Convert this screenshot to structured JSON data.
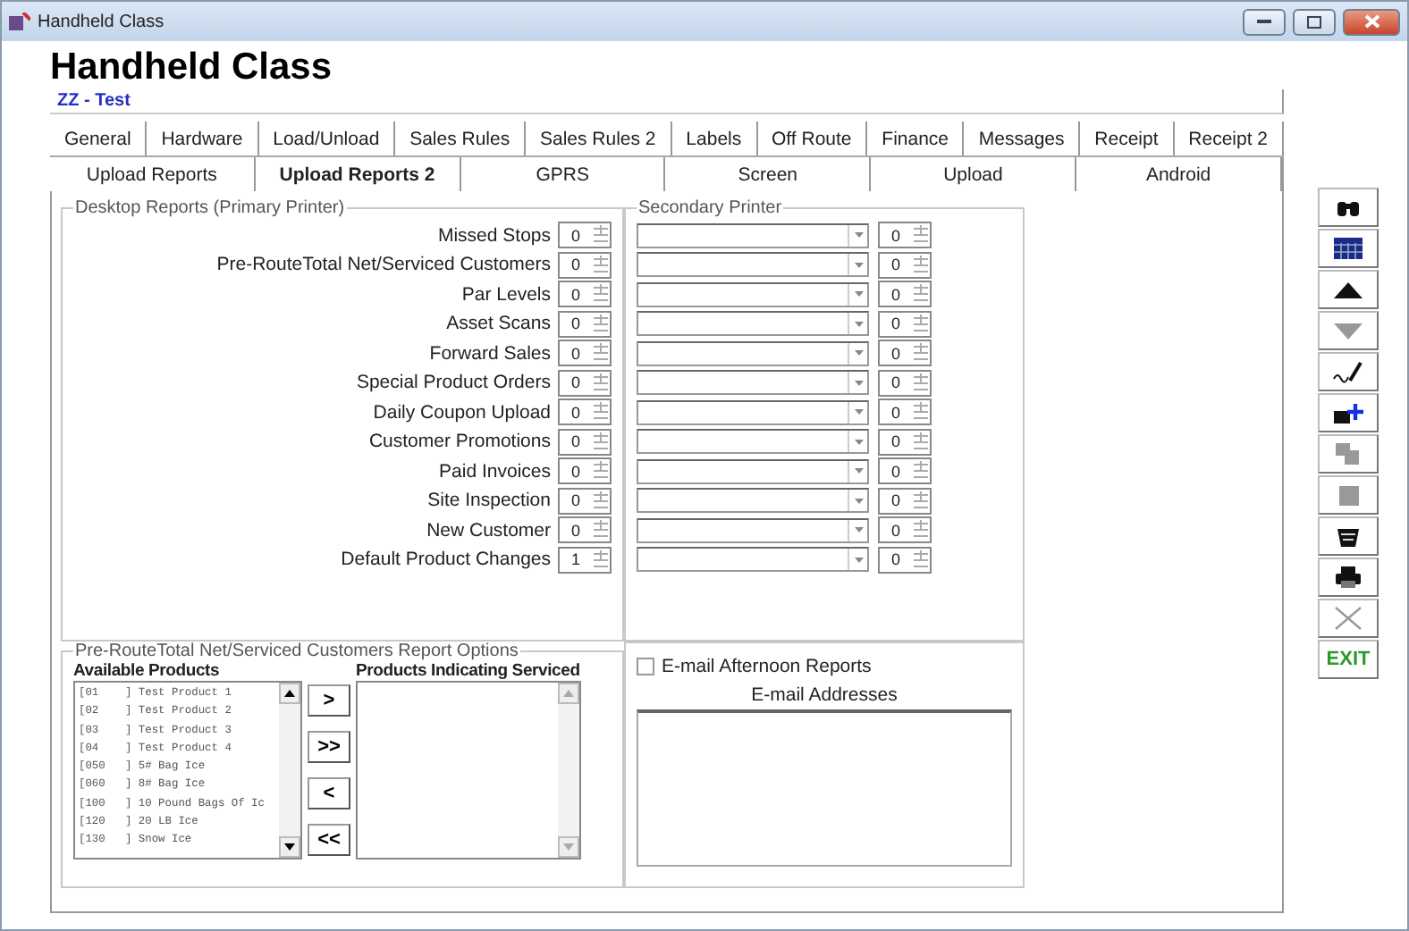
{
  "window": {
    "title": "Handheld Class"
  },
  "heading": "Handheld Class",
  "class_field": {
    "value": "ZZ - Test"
  },
  "tab_rows": [
    [
      {
        "label": "General",
        "selected": false
      },
      {
        "label": "Hardware",
        "selected": false
      },
      {
        "label": "Load/Unload",
        "selected": false
      },
      {
        "label": "Sales Rules",
        "selected": false
      },
      {
        "label": "Sales Rules 2",
        "selected": false
      },
      {
        "label": "Labels",
        "selected": false
      },
      {
        "label": "Off Route",
        "selected": false
      },
      {
        "label": "Finance",
        "selected": false
      },
      {
        "label": "Messages",
        "selected": false
      },
      {
        "label": "Receipt",
        "selected": false
      },
      {
        "label": "Receipt 2",
        "selected": false
      }
    ],
    [
      {
        "label": "Upload Reports",
        "selected": false
      },
      {
        "label": "Upload Reports 2",
        "selected": true
      },
      {
        "label": "GPRS",
        "selected": false
      },
      {
        "label": "Screen",
        "selected": false
      },
      {
        "label": "Upload",
        "selected": false
      },
      {
        "label": "Android",
        "selected": false
      }
    ]
  ],
  "desktop_reports": {
    "title": "Desktop Reports (Primary Printer)",
    "rows": [
      {
        "label": "Missed Stops",
        "copies": "0"
      },
      {
        "label": "Pre-RouteTotal Net/Serviced Customers",
        "copies": "0"
      },
      {
        "label": "Par Levels",
        "copies": "0"
      },
      {
        "label": "Asset Scans",
        "copies": "0"
      },
      {
        "label": "Forward Sales",
        "copies": "0"
      },
      {
        "label": "Special Product Orders",
        "copies": "0"
      },
      {
        "label": "Daily Coupon Upload",
        "copies": "0"
      },
      {
        "label": "Customer Promotions",
        "copies": "0"
      },
      {
        "label": "Paid Invoices",
        "copies": "0"
      },
      {
        "label": "Site Inspection",
        "copies": "0"
      },
      {
        "label": "New Customer",
        "copies": "0"
      },
      {
        "label": "Default Product Changes",
        "copies": "1"
      }
    ]
  },
  "secondary_printer": {
    "title": "Secondary Printer",
    "rows": [
      {
        "copies": "0"
      },
      {
        "copies": "0"
      },
      {
        "copies": "0"
      },
      {
        "copies": "0"
      },
      {
        "copies": "0"
      },
      {
        "copies": "0"
      },
      {
        "copies": "0"
      },
      {
        "copies": "0"
      },
      {
        "copies": "0"
      },
      {
        "copies": "0"
      },
      {
        "copies": "0"
      },
      {
        "copies": "0"
      }
    ]
  },
  "report_options": {
    "title": "Pre-RouteTotal Net/Serviced Customers Report Options",
    "available_title": "Available Products",
    "available": [
      "[01    ] Test Product 1",
      "[02    ] Test Product 2",
      "[03    ] Test Product 3",
      "[04    ] Test Product 4",
      "[050   ] 5# Bag Ice",
      "[060   ] 8# Bag Ice",
      "[100   ] 10 Pound Bags Of Ic",
      "[120   ] 20 LB Ice",
      "[130   ] Snow Ice"
    ],
    "move_buttons": [
      ">",
      ">>",
      "<",
      "<<"
    ],
    "serviced_title": "Products Indicating Serviced"
  },
  "email": {
    "checkbox": {
      "label": "E-mail Afternoon Reports",
      "checked": false
    },
    "addresses_title": "E-mail Addresses"
  },
  "toolbar": [
    {
      "kind": "binoculars",
      "disabled": false
    },
    {
      "kind": "grid",
      "disabled": false
    },
    {
      "kind": "up",
      "disabled": false
    },
    {
      "kind": "down",
      "disabled": true
    },
    {
      "kind": "signature",
      "disabled": false
    },
    {
      "kind": "add",
      "disabled": false
    },
    {
      "kind": "copy",
      "disabled": true
    },
    {
      "kind": "stop",
      "disabled": true
    },
    {
      "kind": "basket",
      "disabled": false
    },
    {
      "kind": "printer",
      "disabled": false
    },
    {
      "kind": "close",
      "disabled": true
    },
    {
      "kind": "exit",
      "label": "EXIT",
      "disabled": false
    }
  ]
}
